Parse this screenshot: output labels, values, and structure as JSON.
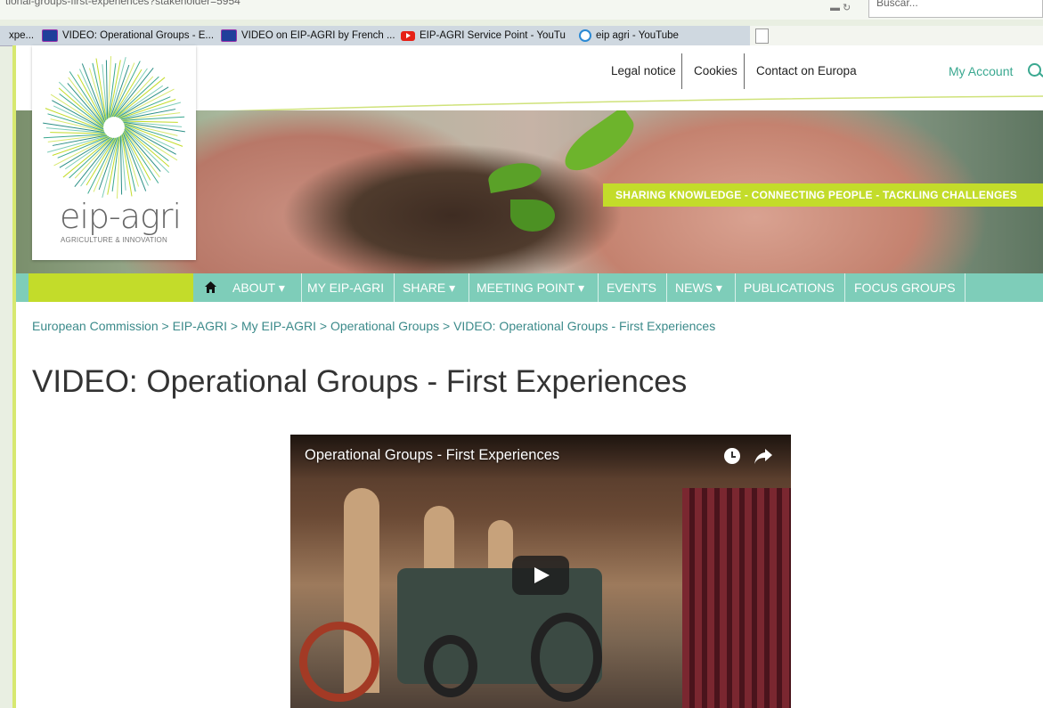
{
  "browser": {
    "url": "tional-groups-first-experiences?stakeholder=5954",
    "search_placeholder": "Buscar...",
    "tabs": [
      {
        "label": "xpe...",
        "icon": "eu-flag-icon"
      },
      {
        "label": "VIDEO: Operational Groups - E...",
        "icon": "eu-flag-icon"
      },
      {
        "label": "VIDEO on EIP-AGRI by French ...",
        "icon": "eu-flag-icon"
      },
      {
        "label": "EIP-AGRI Service Point - YouTu",
        "icon": "youtube-icon"
      },
      {
        "label": "eip agri - YouTube",
        "icon": "ie-icon"
      }
    ]
  },
  "top_links": {
    "legal": "Legal notice",
    "cookies": "Cookies",
    "contact": "Contact on Europa",
    "account": "My Account"
  },
  "logo": {
    "name": "eip-agri",
    "subtitle": "AGRICULTURE & INNOVATION"
  },
  "tagline": "SHARING KNOWLEDGE - CONNECTING PEOPLE - TACKLING CHALLENGES",
  "nav": {
    "items": [
      "ABOUT",
      "MY EIP-AGRI",
      "SHARE",
      "MEETING POINT",
      "EVENTS",
      "NEWS",
      "PUBLICATIONS",
      "FOCUS GROUPS"
    ]
  },
  "breadcrumb": "European Commission > EIP-AGRI > My EIP-AGRI > Operational Groups > VIDEO: Operational Groups - First Experiences",
  "page_title": "VIDEO: Operational Groups - First Experiences",
  "video": {
    "title": "Operational Groups - First Experiences"
  },
  "colors": {
    "accent_green": "#7ecdb9",
    "lime": "#c3dc2a",
    "link_teal": "#3aa890"
  }
}
